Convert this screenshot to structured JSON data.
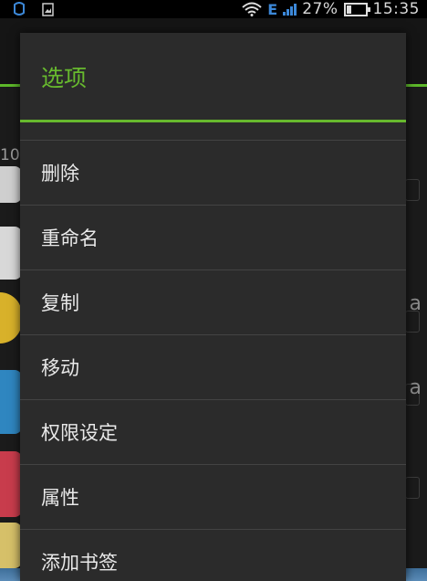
{
  "status_bar": {
    "network_type": "E",
    "battery_percent": "27%",
    "time": "15:35",
    "icons": [
      "notification-icon",
      "image-icon",
      "wifi-icon",
      "signal-icon",
      "battery-icon"
    ]
  },
  "background": {
    "row_number_fragment": "10",
    "right_letter_a": "a"
  },
  "dialog": {
    "title": "选项",
    "items": [
      {
        "label": "删除"
      },
      {
        "label": "重命名"
      },
      {
        "label": "复制"
      },
      {
        "label": "移动"
      },
      {
        "label": "权限设定"
      },
      {
        "label": "属性"
      },
      {
        "label": "添加书签"
      }
    ]
  },
  "colors": {
    "accent": "#67b92e",
    "dialog_bg": "#2b2b2b",
    "divider": "#434343",
    "item_text": "#e9e9e9",
    "status_net": "#3c88d8"
  }
}
